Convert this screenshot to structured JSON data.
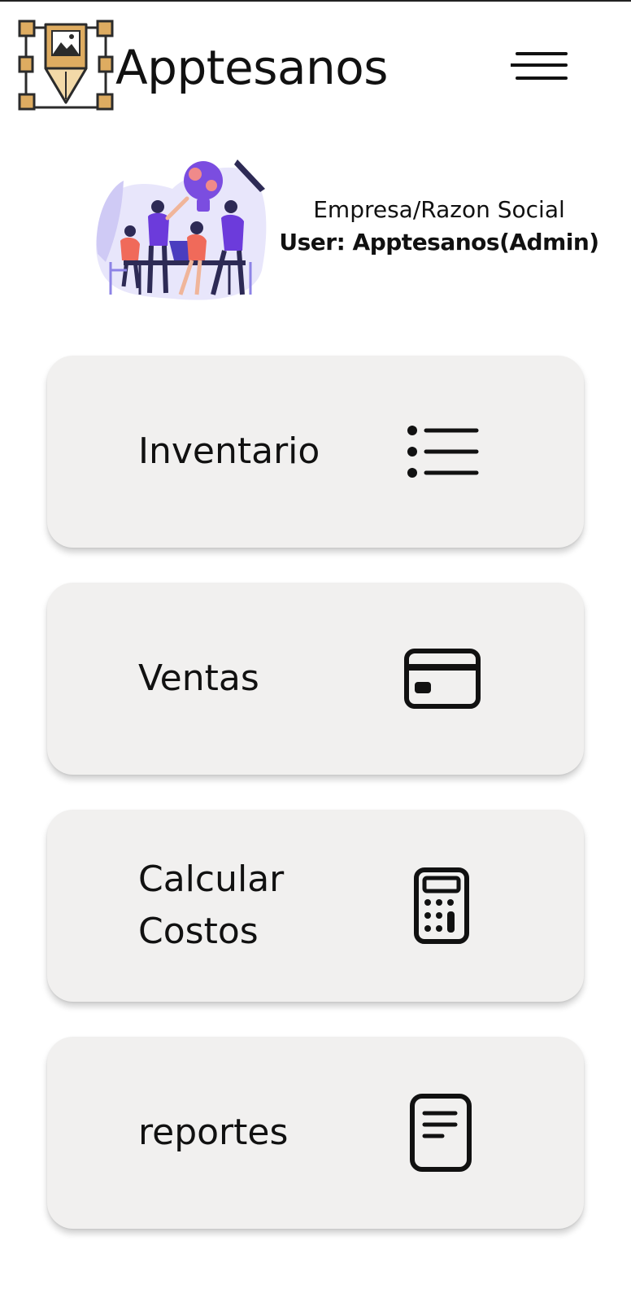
{
  "header": {
    "app_title": "Apptesanos",
    "logo_icon": "pencil-frame-logo-icon",
    "menu_icon": "hamburger-menu-icon",
    "brand_color": "#deac61"
  },
  "profile": {
    "company": "Empresa/Razon Social",
    "user": "User: Apptesanos(Admin)",
    "illustration": "team-brainstorm-illustration",
    "illustration_accent": "#6c3bdb"
  },
  "menu": {
    "items": [
      {
        "label": "Inventario",
        "icon": "list-icon"
      },
      {
        "label": "Ventas",
        "icon": "credit-card-icon"
      },
      {
        "label": "Calcular\nCostos",
        "icon": "calculator-icon"
      },
      {
        "label": "reportes",
        "icon": "document-icon"
      }
    ],
    "card_color": "#f1f0ef"
  }
}
